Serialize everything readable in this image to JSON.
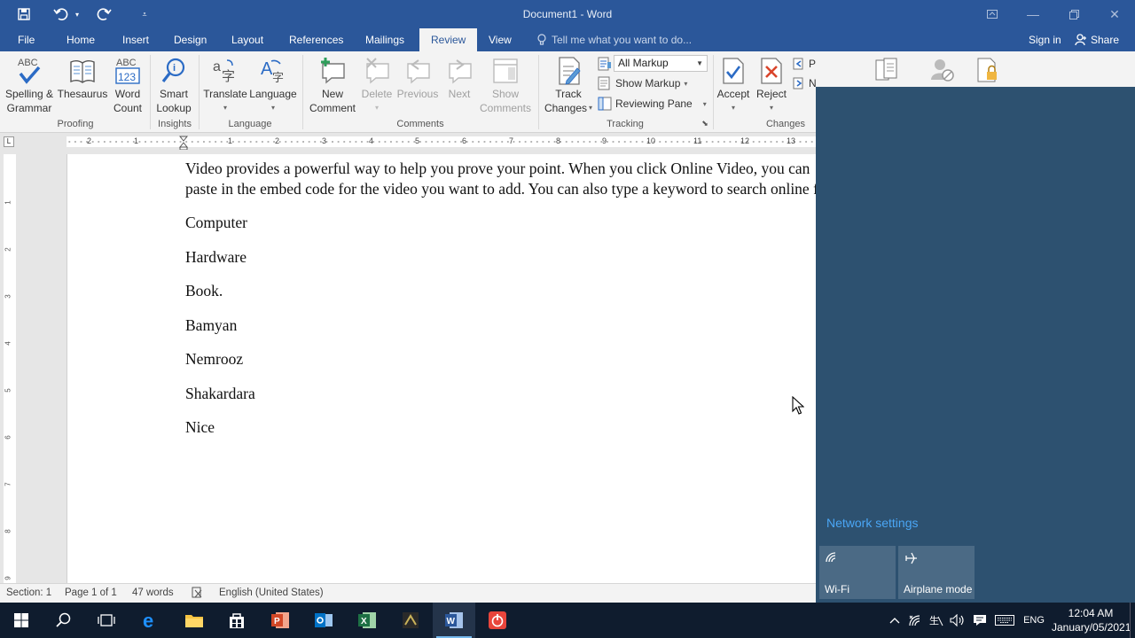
{
  "window": {
    "title": "Document1 - Word"
  },
  "tabs": {
    "file": "File",
    "home": "Home",
    "insert": "Insert",
    "design": "Design",
    "layout": "Layout",
    "references": "References",
    "mailings": "Mailings",
    "review": "Review",
    "view": "View",
    "tell_me": "Tell me what you want to do...",
    "sign_in": "Sign in",
    "share": "Share"
  },
  "ribbon": {
    "proofing": {
      "group": "Proofing",
      "spelling_l1": "Spelling &",
      "spelling_l2": "Grammar",
      "thesaurus": "Thesaurus",
      "wordcount_l1": "Word",
      "wordcount_l2": "Count"
    },
    "insights": {
      "group": "Insights",
      "smart_l1": "Smart",
      "smart_l2": "Lookup"
    },
    "language": {
      "group": "Language",
      "translate": "Translate",
      "language": "Language"
    },
    "comments": {
      "group": "Comments",
      "new_l1": "New",
      "new_l2": "Comment",
      "delete": "Delete",
      "previous": "Previous",
      "next": "Next",
      "show_l1": "Show",
      "show_l2": "Comments"
    },
    "tracking": {
      "group": "Tracking",
      "track_l1": "Track",
      "track_l2": "Changes",
      "markup_value": "All Markup",
      "show_markup": "Show Markup",
      "reviewing_pane": "Reviewing Pane"
    },
    "changes": {
      "group": "Changes",
      "accept": "Accept",
      "reject": "Reject",
      "previous": "Previous",
      "next": "Next"
    }
  },
  "ruler": {
    "marks": [
      "2",
      "1",
      "1",
      "2",
      "3",
      "4",
      "5",
      "6",
      "7",
      "8",
      "9",
      "10",
      "11",
      "12",
      "13"
    ],
    "vmarks": [
      "1",
      "2",
      "3",
      "4",
      "5",
      "6",
      "7",
      "8",
      "9"
    ]
  },
  "document": {
    "line1": "Video provides a powerful way to help you prove your point. When you click Online Video, you can",
    "line2": "paste in the embed code for the video you want to add. You can also type a keyword to search online for",
    "items": [
      "Computer",
      "Hardware",
      "Book.",
      "Bamyan",
      "Nemrooz",
      "Shakardara",
      "Nice"
    ]
  },
  "status": {
    "section": "Section: 1",
    "page": "Page 1 of 1",
    "words": "47 words",
    "language": "English (United States)"
  },
  "action_center": {
    "network_settings": "Network settings",
    "wifi": "Wi-Fi",
    "airplane": "Airplane mode"
  },
  "taskbar": {
    "lang": "ENG",
    "time": "12:04 AM",
    "date": "January/05/2021"
  },
  "colors": {
    "word_blue": "#2b579a",
    "action_center": "#2d5170",
    "taskbar": "#0f1c2e",
    "link": "#4aa6f5"
  }
}
